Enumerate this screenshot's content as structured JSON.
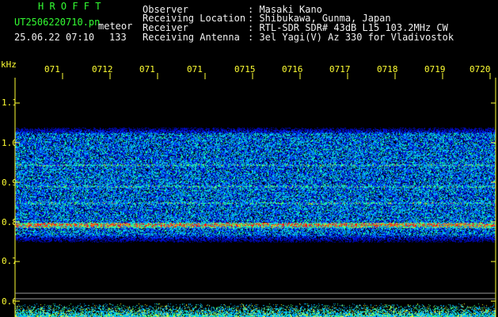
{
  "header": {
    "program": "H R O F F T",
    "filename": "UT2506220710.pn",
    "mode": "meteor",
    "datetime": "25.06.22 07:10",
    "count": "133",
    "fields": [
      {
        "label": "Observer",
        "value": ": Masaki Kano"
      },
      {
        "label": "Receiving Location",
        "value": ": Shibukawa, Gunma, Japan"
      },
      {
        "label": "Receiver",
        "value": ": RTL-SDR SDR# 43dB L15 103.2MHz CW"
      },
      {
        "label": "Receiving Antenna",
        "value": ": 3el Yagi(V) Az 330 for Vladivostok"
      }
    ]
  },
  "time_axis": {
    "ticks": [
      "071",
      "0712",
      "071",
      "071",
      "0715",
      "0716",
      "0717",
      "0718",
      "0719",
      "0720"
    ]
  },
  "freq_axis": {
    "unit": "kHz",
    "ticks": [
      "1.1",
      "1.0",
      "0.9",
      "0.8",
      "0.7",
      "0.6"
    ]
  },
  "colors": {
    "background": "#000000",
    "noise_low": "#0a14c8",
    "noise_mid": "#00a0ff",
    "signal": "#00ff80",
    "peak": "#ff2020",
    "title": "#33ff33",
    "label": "#ffff33"
  }
}
